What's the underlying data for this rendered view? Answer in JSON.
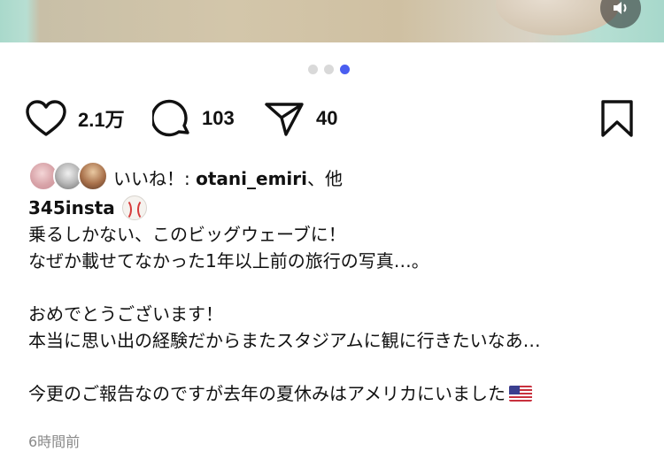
{
  "post": {
    "carousel": {
      "total": 3,
      "active_index": 2
    },
    "actions": {
      "like_count": "2.1万",
      "comment_count": "103",
      "share_count": "40"
    },
    "liked_by": {
      "prefix": "いいね！: ",
      "user": "otani_emiri",
      "suffix": "、他"
    },
    "caption": {
      "username": "345insta",
      "lines": [
        "乗るしかない、このビッグウェーブに！",
        "なぜか載せてなかった1年以上前の旅行の写真…。",
        "",
        "おめでとうございます！",
        "本当に思い出の経験だからまたスタジアムに観に行きたいなあ…",
        "",
        "今更のご報告なのですが去年の夏休みはアメリカにいました"
      ]
    },
    "timestamp": "6時間前"
  },
  "icons": {
    "like": "heart-outline-icon",
    "comment": "comment-bubble-icon",
    "share": "paper-plane-icon",
    "save": "bookmark-icon",
    "mute": "speaker-icon"
  },
  "colors": {
    "active_dot": "#4a5ef0",
    "inactive_dot": "#d9d9d9",
    "timestamp": "#8a8a8a"
  }
}
